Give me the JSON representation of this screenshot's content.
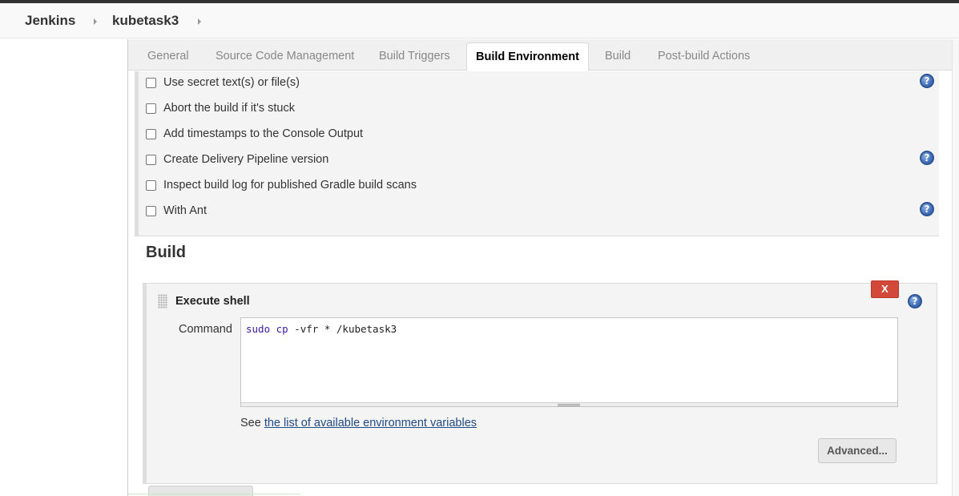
{
  "breadcrumbs": {
    "items": [
      "Jenkins",
      "kubetask3"
    ]
  },
  "tabs": [
    {
      "label": "General",
      "active": false
    },
    {
      "label": "Source Code Management",
      "active": false
    },
    {
      "label": "Build Triggers",
      "active": false
    },
    {
      "label": "Build Environment",
      "active": true
    },
    {
      "label": "Build",
      "active": false
    },
    {
      "label": "Post-build Actions",
      "active": false
    }
  ],
  "build_environment": {
    "options": [
      {
        "label": "Use secret text(s) or file(s)",
        "checked": false,
        "has_help": true
      },
      {
        "label": "Abort the build if it's stuck",
        "checked": false,
        "has_help": false
      },
      {
        "label": "Add timestamps to the Console Output",
        "checked": false,
        "has_help": false
      },
      {
        "label": "Create Delivery Pipeline version",
        "checked": false,
        "has_help": true
      },
      {
        "label": "Inspect build log for published Gradle build scans",
        "checked": false,
        "has_help": false
      },
      {
        "label": "With Ant",
        "checked": false,
        "has_help": true
      }
    ]
  },
  "build": {
    "section_title": "Build",
    "step": {
      "title": "Execute shell",
      "delete_label": "X",
      "help_glyph": "?",
      "command_label": "Command",
      "command_keyword": "sudo cp",
      "command_rest": " -vfr * /kubetask3",
      "see_prefix": "See ",
      "env_vars_link": "the list of available environment variables",
      "advanced_label": "Advanced..."
    }
  },
  "colors": {
    "delete_button": "#d24939",
    "help_icon": "#3a68b5",
    "link": "#204a87",
    "command_keyword": "#3a1bb0"
  }
}
